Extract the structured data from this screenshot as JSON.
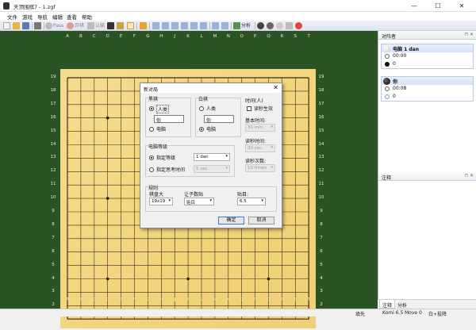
{
  "window": {
    "title": "天顶围棋7 - 1.zgf",
    "minimize": "—",
    "maximize": "☐",
    "close": "✕"
  },
  "menu": [
    "文件",
    "游戏",
    "导航",
    "编辑",
    "查看",
    "帮助"
  ],
  "toolbar": {
    "pass_label": "Pass",
    "resign_label": "弃棋",
    "count_label": "认输",
    "analyze_label": "分析"
  },
  "board": {
    "columns": [
      "A",
      "B",
      "C",
      "D",
      "E",
      "F",
      "G",
      "H",
      "J",
      "K",
      "L",
      "M",
      "N",
      "O",
      "P",
      "Q",
      "R",
      "S",
      "T"
    ],
    "rows": [
      "19",
      "18",
      "17",
      "16",
      "15",
      "14",
      "13",
      "12",
      "11",
      "10",
      "9",
      "8",
      "7",
      "6",
      "5",
      "4",
      "3",
      "2",
      "1"
    ]
  },
  "dialog": {
    "title": "新对局",
    "close": "✕",
    "black": {
      "group": "黑棋",
      "human": "人类",
      "name": "你",
      "computer": "电脑"
    },
    "white": {
      "group": "白棋",
      "human": "人类",
      "name": "你",
      "computer": "电脑"
    },
    "time": {
      "group": "时间(人)",
      "option": "读秒生效",
      "base_label": "基本时间:",
      "base_value": "30 min.",
      "byo_label": "读秒时间:",
      "byo_value": "30 sec.",
      "count_label": "读秒次数:",
      "count_value": "10 times"
    },
    "computer_level": {
      "group": "电脑等级",
      "opt1": "指定等级",
      "level_value": "1 dan",
      "opt2": "指定思考时间",
      "think_value": "5 sec."
    },
    "rules": {
      "group": "规则",
      "size_label": "棋盘大",
      "size_value": "19x19",
      "handicap_label": "让子数贴",
      "handicap_value": "贴目",
      "komi_label": "贴目:",
      "komi_value": "6.5"
    },
    "ok": "确定",
    "cancel": "取消"
  },
  "right_panel": {
    "players_title": "对阵者",
    "black_player": {
      "name": "电脑 1 dan",
      "time": "00:00",
      "captures": "0"
    },
    "white_player": {
      "name": "你",
      "time": "00:08",
      "captures": "0"
    },
    "comments_title": "注释",
    "pin": "⊓ ✕"
  },
  "tabs": [
    "注释",
    "分析"
  ],
  "status": {
    "state": "填先",
    "komi": "Komi 6.5",
    "move": "Move 0",
    "mode": "白+投降"
  }
}
